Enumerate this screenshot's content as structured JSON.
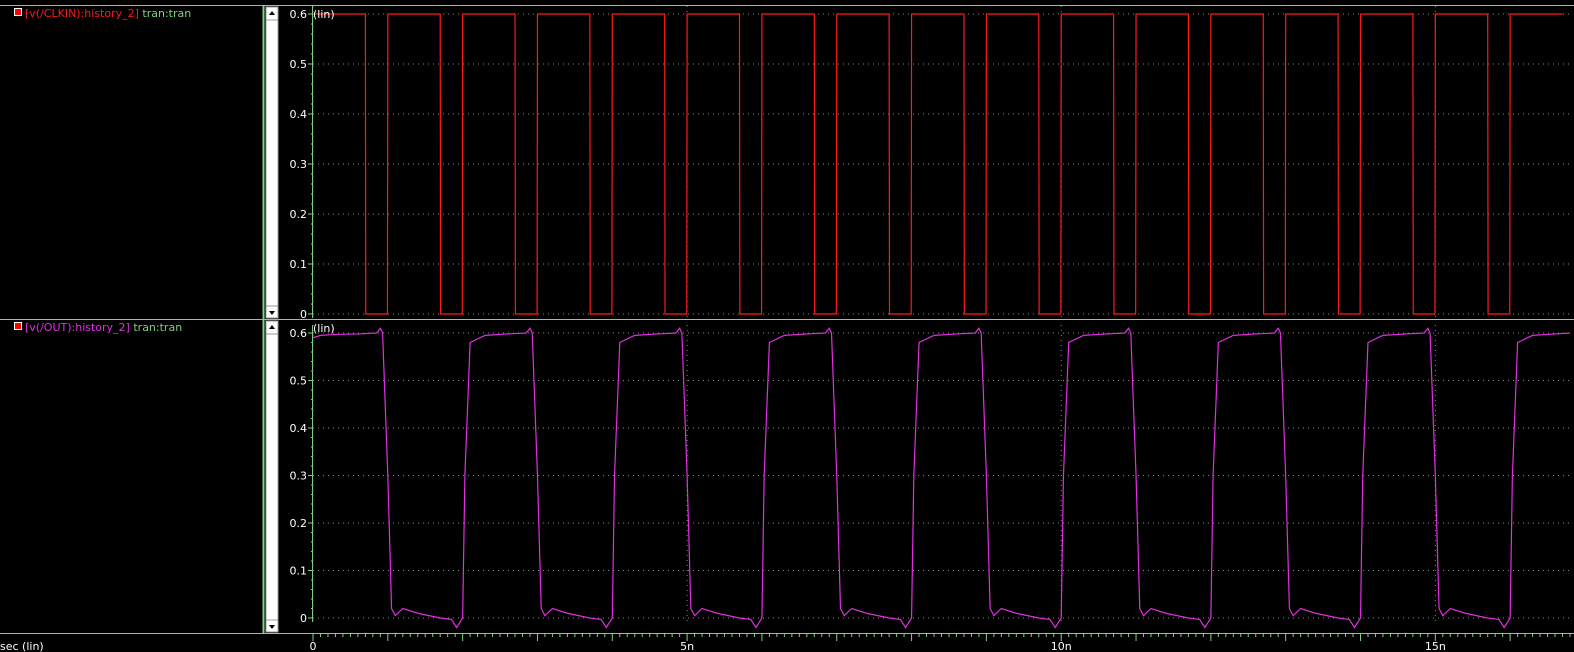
{
  "colors": {
    "background": "#000000",
    "grid": "#8a8a8a",
    "axis": "#7fd27f",
    "tick_text": "#ffffff",
    "clk": "#ff1a1a",
    "out": "#e030e0",
    "context": "#7fd27f"
  },
  "strips": [
    {
      "legend": {
        "name": "[v(/CLKIN):history_2]",
        "context": "tran:tran"
      },
      "scale_tag": "(lin)"
    },
    {
      "legend": {
        "name": "[v(/OUT):history_2]",
        "context": "tran:tran"
      },
      "scale_tag": "(lin)"
    }
  ],
  "x_axis": {
    "label": "sec (lin)",
    "ticks": [
      {
        "value": 0,
        "label": "0"
      },
      {
        "value": 5e-09,
        "label": "5n"
      },
      {
        "value": 1e-08,
        "label": "10n"
      },
      {
        "value": 1.5e-08,
        "label": "15n"
      }
    ]
  },
  "chart_data": [
    {
      "type": "line",
      "series": [
        {
          "name": "[v(/CLKIN):history_2]",
          "x": [
            0,
            7e-10,
            7.05e-10,
            9.95e-10,
            1e-09,
            1.7e-09,
            1.705e-09,
            1.995e-09,
            2e-09,
            2.7e-09,
            2.705e-09,
            2.995e-09,
            3e-09,
            3.7e-09,
            3.705e-09,
            3.995e-09,
            4e-09,
            4.7e-09,
            4.705e-09,
            4.995e-09,
            5e-09,
            5.7e-09,
            5.705e-09,
            5.995e-09,
            6e-09,
            6.7e-09,
            6.705e-09,
            6.995e-09,
            7e-09,
            7.7e-09,
            7.705e-09,
            7.995e-09,
            8e-09,
            8.7e-09,
            8.705e-09,
            8.995e-09,
            9e-09,
            9.7e-09,
            9.705e-09,
            9.995e-09,
            1e-08,
            1.07e-08,
            1.0705e-08,
            1.0995e-08,
            1.1e-08,
            1.17e-08,
            1.1705e-08,
            1.1995e-08,
            1.2e-08,
            1.27e-08,
            1.2705e-08,
            1.2995e-08,
            1.3e-08,
            1.37e-08,
            1.3705e-08,
            1.3995e-08,
            1.4e-08,
            1.47e-08,
            1.4705e-08,
            1.4995e-08,
            1.5e-08,
            1.57e-08,
            1.5705e-08,
            1.5995e-08,
            1.6e-08,
            1.67e-08
          ],
          "y": [
            0.6,
            0.6,
            0,
            0,
            0.6,
            0.6,
            0,
            0,
            0.6,
            0.6,
            0,
            0,
            0.6,
            0.6,
            0,
            0,
            0.6,
            0.6,
            0,
            0,
            0.6,
            0.6,
            0,
            0,
            0.6,
            0.6,
            0,
            0,
            0.6,
            0.6,
            0,
            0,
            0.6,
            0.6,
            0,
            0,
            0.6,
            0.6,
            0,
            0,
            0.6,
            0.6,
            0,
            0,
            0.6,
            0.6,
            0,
            0,
            0.6,
            0.6,
            0,
            0,
            0.6,
            0.6,
            0,
            0,
            0.6,
            0.6,
            0,
            0,
            0.6,
            0.6,
            0,
            0,
            0.6,
            0.6
          ]
        }
      ],
      "xlim": [
        0,
        1.68e-08
      ],
      "ylim": [
        0,
        0.6
      ],
      "yticks": [
        0,
        0.1,
        0.2,
        0.3,
        0.4,
        0.5,
        0.6
      ],
      "grid": true
    },
    {
      "type": "line",
      "series": [
        {
          "name": "[v(/OUT):history_2]",
          "x": [
            0,
            1e-10,
            3e-10,
            6e-10,
            8.5e-10,
            9e-10,
            9.3e-10,
            1e-09,
            1.05e-09,
            1.1e-09,
            1.2e-09,
            1.4e-09,
            1.7e-09,
            1.85e-09,
            1.92e-09,
            2e-09,
            2.03e-09,
            2.1e-09,
            2.3e-09,
            2.6e-09,
            2.85e-09,
            2.9e-09,
            2.93e-09,
            3e-09,
            3.05e-09,
            3.1e-09,
            3.2e-09,
            3.4e-09,
            3.7e-09,
            3.85e-09,
            3.92e-09,
            4e-09,
            4.03e-09,
            4.1e-09,
            4.3e-09,
            4.6e-09,
            4.85e-09,
            4.9e-09,
            4.93e-09,
            5e-09,
            5.05e-09,
            5.1e-09,
            5.2e-09,
            5.4e-09,
            5.7e-09,
            5.85e-09,
            5.92e-09,
            6e-09,
            6.03e-09,
            6.1e-09,
            6.3e-09,
            6.6e-09,
            6.85e-09,
            6.9e-09,
            6.93e-09,
            7e-09,
            7.05e-09,
            7.1e-09,
            7.2e-09,
            7.4e-09,
            7.7e-09,
            7.85e-09,
            7.92e-09,
            8e-09,
            8.03e-09,
            8.1e-09,
            8.3e-09,
            8.6e-09,
            8.85e-09,
            8.9e-09,
            8.93e-09,
            9e-09,
            9.05e-09,
            9.1e-09,
            9.2e-09,
            9.4e-09,
            9.7e-09,
            9.85e-09,
            9.92e-09,
            1e-08,
            1.003e-08,
            1.01e-08,
            1.03e-08,
            1.06e-08,
            1.085e-08,
            1.09e-08,
            1.093e-08,
            1.1e-08,
            1.105e-08,
            1.11e-08,
            1.12e-08,
            1.14e-08,
            1.17e-08,
            1.185e-08,
            1.192e-08,
            1.2e-08,
            1.203e-08,
            1.21e-08,
            1.23e-08,
            1.26e-08,
            1.285e-08,
            1.29e-08,
            1.293e-08,
            1.3e-08,
            1.305e-08,
            1.31e-08,
            1.32e-08,
            1.34e-08,
            1.37e-08,
            1.385e-08,
            1.392e-08,
            1.4e-08,
            1.403e-08,
            1.41e-08,
            1.43e-08,
            1.46e-08,
            1.485e-08,
            1.49e-08,
            1.493e-08,
            1.5e-08,
            1.505e-08,
            1.51e-08,
            1.52e-08,
            1.54e-08,
            1.57e-08,
            1.585e-08,
            1.592e-08,
            1.6e-08,
            1.603e-08,
            1.61e-08,
            1.63e-08,
            1.66e-08,
            1.68e-08
          ],
          "y": [
            0.59,
            0.595,
            0.597,
            0.598,
            0.6,
            0.61,
            0.6,
            0.3,
            0.02,
            0.005,
            0.02,
            0.01,
            0.0,
            -0.003,
            -0.02,
            0.0,
            0.3,
            0.58,
            0.595,
            0.598,
            0.6,
            0.61,
            0.6,
            0.3,
            0.02,
            0.005,
            0.02,
            0.01,
            0.0,
            -0.003,
            -0.02,
            0.0,
            0.3,
            0.58,
            0.595,
            0.598,
            0.6,
            0.61,
            0.6,
            0.3,
            0.02,
            0.005,
            0.02,
            0.01,
            0.0,
            -0.003,
            -0.02,
            0.0,
            0.3,
            0.58,
            0.595,
            0.598,
            0.6,
            0.61,
            0.6,
            0.3,
            0.02,
            0.005,
            0.02,
            0.01,
            0.0,
            -0.003,
            -0.02,
            0.0,
            0.3,
            0.58,
            0.595,
            0.598,
            0.6,
            0.61,
            0.6,
            0.3,
            0.02,
            0.005,
            0.02,
            0.01,
            0.0,
            -0.003,
            -0.02,
            0.0,
            0.3,
            0.58,
            0.595,
            0.598,
            0.6,
            0.61,
            0.6,
            0.3,
            0.02,
            0.005,
            0.02,
            0.01,
            0.0,
            -0.003,
            -0.02,
            0.0,
            0.3,
            0.58,
            0.595,
            0.598,
            0.6,
            0.61,
            0.6,
            0.3,
            0.02,
            0.005,
            0.02,
            0.01,
            0.0,
            -0.003,
            -0.02,
            0.0,
            0.3,
            0.58,
            0.595,
            0.598,
            0.6,
            0.61,
            0.6,
            0.3,
            0.02,
            0.005,
            0.02,
            0.01,
            0.0,
            -0.003,
            -0.02,
            0.0,
            0.3,
            0.58,
            0.595,
            0.598,
            0.6
          ]
        }
      ],
      "xlim": [
        0,
        1.68e-08
      ],
      "ylim": [
        0,
        0.6
      ],
      "yticks": [
        0,
        0.1,
        0.2,
        0.3,
        0.4,
        0.5,
        0.6
      ],
      "grid": true
    }
  ]
}
